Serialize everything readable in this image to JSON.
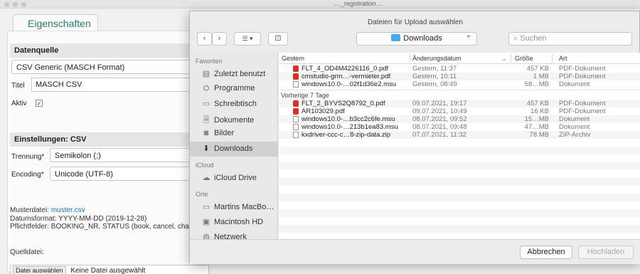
{
  "window": {
    "title": "…_registration…"
  },
  "page": {
    "tab": "Eigenschaften",
    "datenquelle": {
      "header": "Datenquelle",
      "selected": "CSV Generic (MASCH Format)"
    },
    "titel": {
      "label": "Titel",
      "value": "MASCH CSV"
    },
    "aktiv": {
      "label": "Aktiv",
      "checked": "✓"
    },
    "einstellungen": {
      "header": "Einstellungen: CSV"
    },
    "trennung": {
      "label": "Trennung*",
      "value": "Semikolon (;)"
    },
    "encoding": {
      "label": "Encoding*",
      "value": "Unicode (UTF-8)"
    },
    "info": {
      "musterdatei_label": "Musterdatei:",
      "musterdatei_link": "muster.csv",
      "datumsformat": "Datumsformat: YYYY-MM-DD (2019-12-28)",
      "pflichtfelder": "Pflichtfelder: BOOKING_NR, STATUS (book, cancel, char"
    },
    "quelldatei": {
      "label": "Quelldatei:",
      "button": "Datei auswählen",
      "status": "Keine Datei ausgewählt"
    }
  },
  "dialog": {
    "title": "Dateien für Upload auswählen",
    "toolbar": {
      "back": "‹",
      "forward": "›",
      "view": "☰ ▾",
      "newfolder": "⊡",
      "location": "Downloads",
      "location_icon": "folder-icon",
      "search_placeholder": "Suchen"
    },
    "sidebar": {
      "favoriten_header": "Favoriten",
      "favoriten": [
        {
          "label": "Zuletzt benutzt",
          "icon": "recent-icon",
          "glyph": "▤"
        },
        {
          "label": "Programme",
          "icon": "apps-icon",
          "glyph": "⛭"
        },
        {
          "label": "Schreibtisch",
          "icon": "desktop-icon",
          "glyph": "▭"
        },
        {
          "label": "Dokumente",
          "icon": "documents-icon",
          "glyph": "🗎"
        },
        {
          "label": "Bilder",
          "icon": "pictures-icon",
          "glyph": "◙"
        },
        {
          "label": "Downloads",
          "icon": "downloads-icon",
          "glyph": "⬇"
        }
      ],
      "icloud_header": "iCloud",
      "icloud": [
        {
          "label": "iCloud Drive",
          "icon": "cloud-icon",
          "glyph": "☁"
        }
      ],
      "orte_header": "Orte",
      "orte": [
        {
          "label": "Martins MacBo…",
          "icon": "laptop-icon",
          "glyph": "▭"
        },
        {
          "label": "Macintosh HD",
          "icon": "disk-icon",
          "glyph": "▣"
        },
        {
          "label": "Netzwerk",
          "icon": "network-icon",
          "glyph": "◍"
        }
      ]
    },
    "columns": {
      "name": "Gestern",
      "date": "Änderungsdatum",
      "size": "Größe",
      "kind": "Art"
    },
    "groups": [
      {
        "label": "Gestern",
        "files": [
          {
            "name": "FLT_4_OD4M4226116_0.pdf",
            "date": "Gestern, 11:37",
            "size": "457 KB",
            "kind": "PDF-Dokument",
            "type": "pdf"
          },
          {
            "name": "cmstudio-grm…-vermieter.pdf",
            "date": "Gestern, 10:11",
            "size": "1 MB",
            "kind": "PDF-Dokument",
            "type": "pdf"
          },
          {
            "name": "windows10.0-…02f1d36e2.msu",
            "date": "Gestern, 08:49",
            "size": "58…MB",
            "kind": "Dokument",
            "type": "doc"
          }
        ]
      },
      {
        "label": "Vorherige 7 Tage",
        "files": [
          {
            "name": "FLT_2_BYVS2Q8792_0.pdf",
            "date": "09.07.2021, 19:17",
            "size": "457 KB",
            "kind": "PDF-Dokument",
            "type": "pdf"
          },
          {
            "name": "AR103029.pdf",
            "date": "09.07.2021, 10:49",
            "size": "16 KB",
            "kind": "PDF-Dokument",
            "type": "pdf"
          },
          {
            "name": "windows10.0-…b3cc2c6fe.msu",
            "date": "08.07.2021, 09:52",
            "size": "15…MB",
            "kind": "Dokument",
            "type": "doc"
          },
          {
            "name": "windows10.0-…213b1ea83.msu",
            "date": "08.07.2021, 09:48",
            "size": "47…MB",
            "kind": "Dokument",
            "type": "doc"
          },
          {
            "name": "kxdriver-ccc-c…8-zip-data.zip",
            "date": "07.07.2021, 11:32",
            "size": "78 MB",
            "kind": "ZIP-Archiv",
            "type": "zip"
          }
        ]
      }
    ],
    "buttons": {
      "cancel": "Abbrechen",
      "upload": "Hochladen"
    }
  }
}
